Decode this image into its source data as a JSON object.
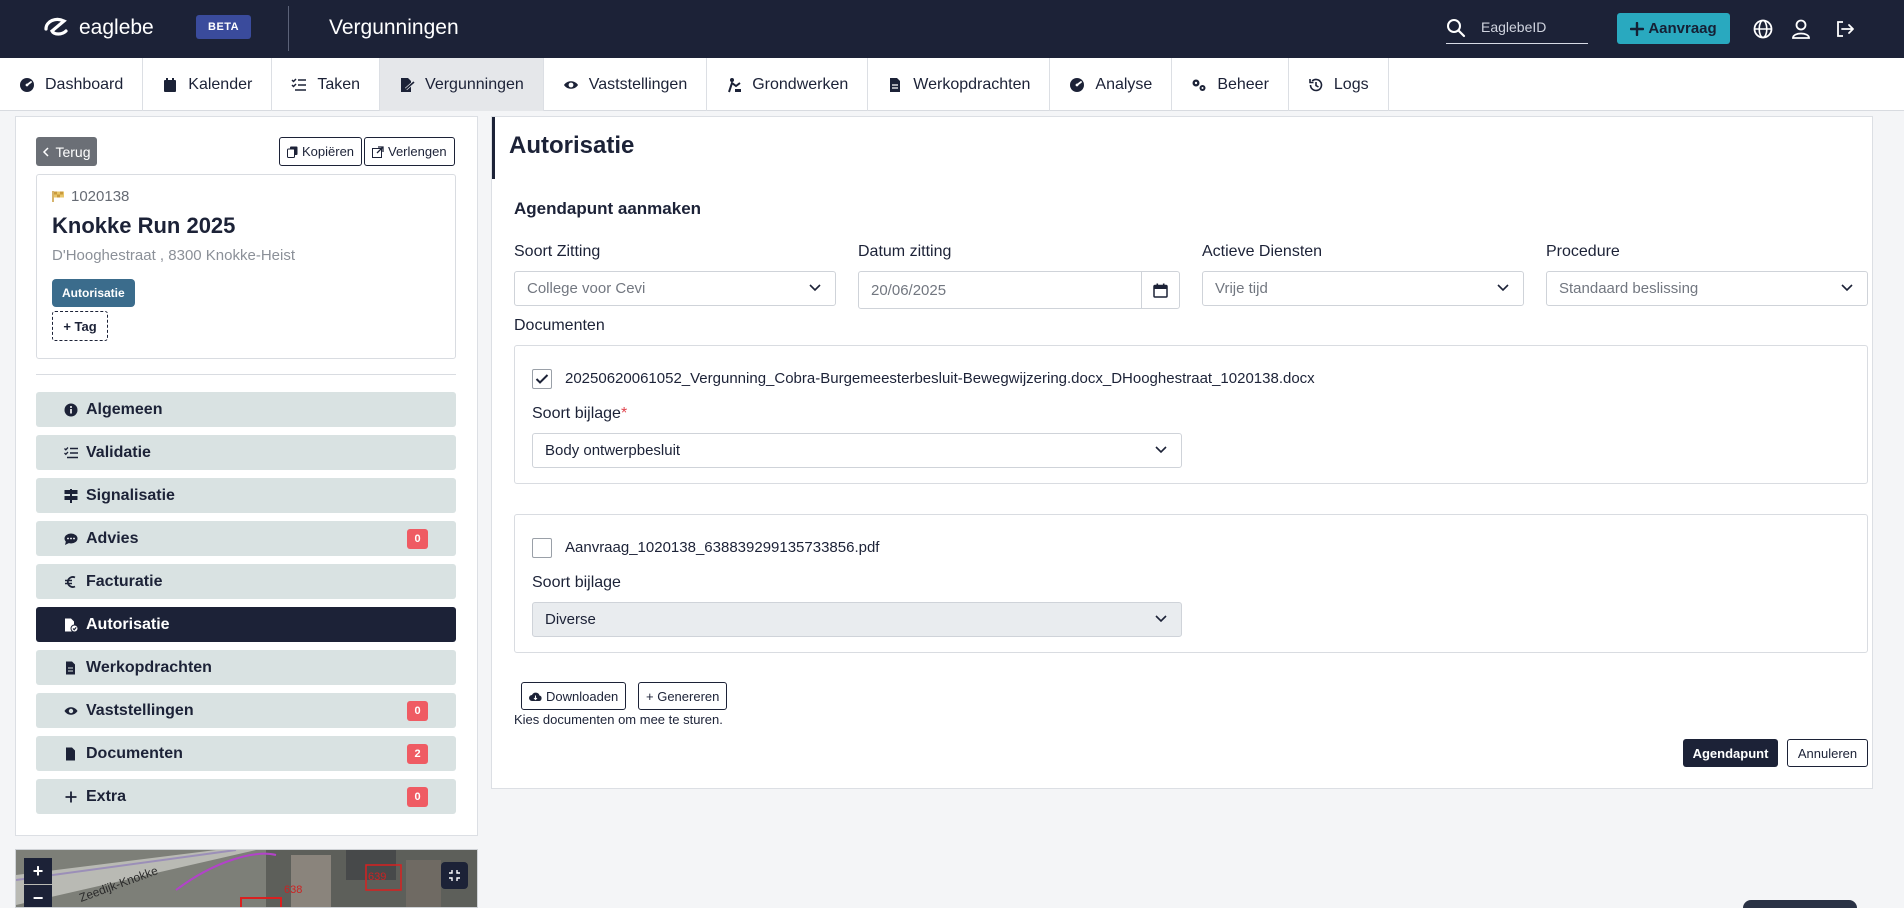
{
  "header": {
    "logo_text": "eaglebe",
    "beta_label": "BETA",
    "app_title": "Vergunningen",
    "search_placeholder": "EaglebeID",
    "new_request_label": "Aanvraag"
  },
  "nav": {
    "items": [
      {
        "label": "Dashboard",
        "icon": "gauge-icon"
      },
      {
        "label": "Kalender",
        "icon": "calendar-icon"
      },
      {
        "label": "Taken",
        "icon": "tasks-icon"
      },
      {
        "label": "Vergunningen",
        "icon": "file-signature-icon",
        "active": true
      },
      {
        "label": "Vaststellingen",
        "icon": "eye-icon"
      },
      {
        "label": "Grondwerken",
        "icon": "digging-icon"
      },
      {
        "label": "Werkopdrachten",
        "icon": "file-icon"
      },
      {
        "label": "Analyse",
        "icon": "gauge-icon"
      },
      {
        "label": "Beheer",
        "icon": "gears-icon"
      },
      {
        "label": "Logs",
        "icon": "history-icon"
      }
    ]
  },
  "sidebar": {
    "back_label": "Terug",
    "copy_label": "Kopiëren",
    "extend_label": "Verlengen",
    "permit": {
      "id": "1020138",
      "title": "Knokke Run 2025",
      "address": "D'Hooghestraat , 8300 Knokke-Heist",
      "status_badge": "Autorisatie",
      "tag_label": "+ Tag"
    },
    "menu": [
      {
        "label": "Algemeen",
        "icon": "info-icon"
      },
      {
        "label": "Validatie",
        "icon": "list-check-icon"
      },
      {
        "label": "Signalisatie",
        "icon": "signs-icon"
      },
      {
        "label": "Advies",
        "icon": "comment-icon",
        "count": "0"
      },
      {
        "label": "Facturatie",
        "icon": "euro-icon"
      },
      {
        "label": "Autorisatie",
        "icon": "file-check-icon",
        "active": true
      },
      {
        "label": "Werkopdrachten",
        "icon": "file-icon"
      },
      {
        "label": "Vaststellingen",
        "icon": "eye-icon",
        "count": "0"
      },
      {
        "label": "Documenten",
        "icon": "document-icon",
        "count": "2"
      },
      {
        "label": "Extra",
        "icon": "plus-icon",
        "count": "0"
      }
    ]
  },
  "map": {
    "zoom_in": "+",
    "zoom_out": "−",
    "street_label": "Zeedijk-Knokke",
    "parcel_1": "639",
    "parcel_2": "638"
  },
  "main": {
    "title": "Autorisatie",
    "section_title": "Agendapunt aanmaken",
    "fields": {
      "soort_zitting_label": "Soort Zitting",
      "soort_zitting_value": "College voor Cevi",
      "datum_zitting_label": "Datum zitting",
      "datum_zitting_value": "20/06/2025",
      "actieve_diensten_label": "Actieve Diensten",
      "actieve_diensten_value": "Vrije tijd",
      "procedure_label": "Procedure",
      "procedure_value": "Standaard beslissing"
    },
    "documents_label": "Documenten",
    "documents": [
      {
        "checked": true,
        "filename": "20250620061052_Vergunning_Cobra-Burgemeesterbesluit-Bewegwijzering.docx_DHooghestraat_1020138.docx",
        "type_label": "Soort bijlage",
        "type_required": "*",
        "type_value": "Body ontwerpbesluit"
      },
      {
        "checked": false,
        "filename": "Aanvraag_1020138_638839299135733856.pdf",
        "type_label": "Soort bijlage",
        "type_value": "Diverse"
      }
    ],
    "download_label": "Downloaden",
    "generate_label": "+ Genereren",
    "hint": "Kies documenten om mee te sturen.",
    "submit_label": "Agendapunt",
    "cancel_label": "Annuleren"
  },
  "colors": {
    "navy": "#1c2237",
    "accent": "#29a9bf",
    "badge": "#3b6c8c",
    "count_badge": "#ef5b63",
    "menu_bg": "#d9e2e2"
  }
}
